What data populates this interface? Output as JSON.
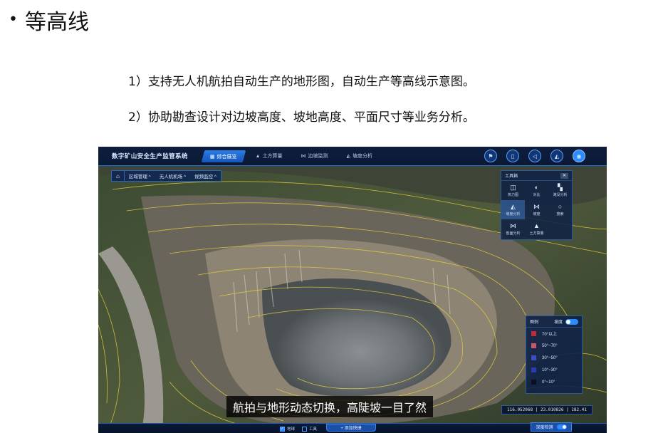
{
  "slide": {
    "bullet": "•",
    "title": "等高线",
    "lines": [
      "1）支持无人机航拍自动生产的地形图，自动生产等高线示意图。",
      "2）协助勘查设计对边坡高度、坡地高度、平面尺寸等业务分析。"
    ]
  },
  "app": {
    "title": "数字矿山安全生产监管系统",
    "tabs": [
      {
        "icon": "▦",
        "label": "综合展览"
      },
      {
        "icon": "▲",
        "label": "土方算量"
      },
      {
        "icon": "⋈",
        "label": "边坡监测"
      },
      {
        "icon": "◭",
        "label": "坡度分析"
      }
    ],
    "top_icons": [
      "flag-icon",
      "book-icon",
      "compass-icon",
      "layers-icon",
      "camera-icon"
    ],
    "subnav": {
      "home_icon": "⌂",
      "items": [
        "区域管理 ^",
        "无人机机场 ^",
        "视频监控 ^"
      ]
    },
    "toolbox": {
      "title": "工具箱",
      "close": "✕",
      "tools": [
        {
          "icon": "◫",
          "label": "热力图"
        },
        {
          "icon": "◐",
          "label": "对比"
        },
        {
          "icon": "▚",
          "label": "淹没分析"
        },
        {
          "icon": "◭",
          "label": "坡度分析"
        },
        {
          "icon": "⋈",
          "label": "坡度"
        },
        {
          "icon": "○",
          "label": "搜索"
        },
        {
          "icon": "⋈",
          "label": "剖面分析"
        },
        {
          "icon": "▲",
          "label": "土方算量"
        }
      ]
    },
    "legend": {
      "title": "图例",
      "toggle_label": "坡度",
      "items": [
        {
          "label": "70°以上",
          "color": "#c02a3a"
        },
        {
          "label": "50°~70°",
          "color": "#c9576b"
        },
        {
          "label": "30°~50°",
          "color": "#3b4fc4"
        },
        {
          "label": "10°~30°",
          "color": "#2a3ab0"
        },
        {
          "label": "0°~10°",
          "color": "#0a0f22"
        }
      ]
    },
    "coords": "116.052068 | 23.010826 | 182.41",
    "subtitle": "航拍与地形动态切换，高陡坡一目了然",
    "bottom": {
      "add_label": "+ 添加快捷",
      "checks": [
        {
          "label": "地球",
          "checked": true
        },
        {
          "label": "工具",
          "checked": false
        }
      ],
      "depth_label": "深度检测"
    }
  }
}
